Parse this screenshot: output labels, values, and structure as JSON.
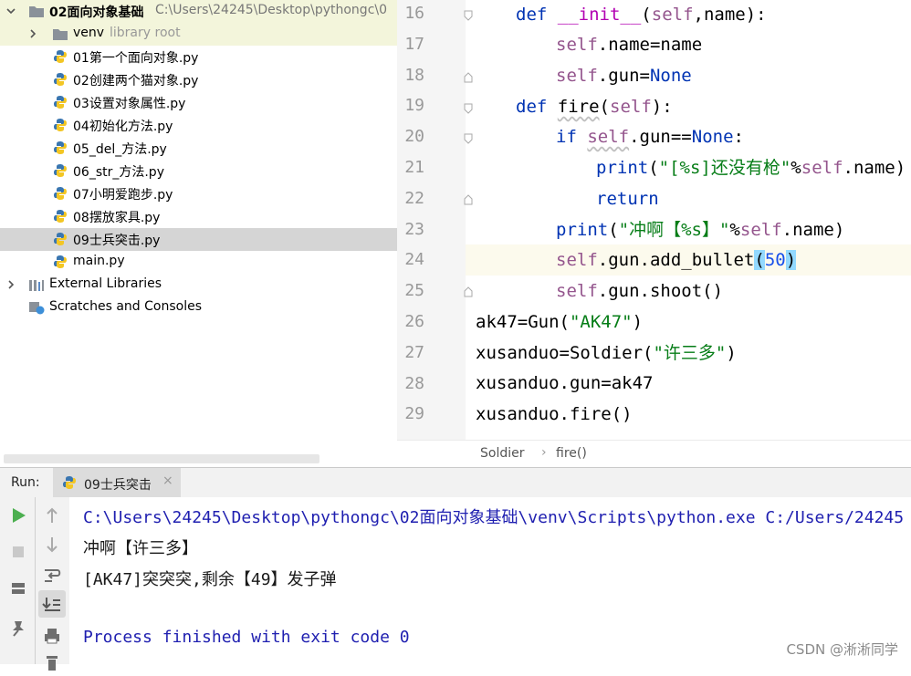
{
  "project_tree": {
    "root": {
      "label": "02面向对象基础",
      "path": "C:\\Users\\24245\\Desktop\\pythongc\\0"
    },
    "venv": {
      "label": "venv",
      "hint": "library root"
    },
    "files": [
      "01第一个面向对象.py",
      "02创建两个猫对象.py",
      "03设置对象属性.py",
      "04初始化方法.py",
      "05_del_方法.py",
      "06_str_方法.py",
      "07小明爱跑步.py",
      "08摆放家具.py",
      "09士兵突击.py",
      "main.py"
    ],
    "selected_file": "09士兵突击.py",
    "external_libraries": "External Libraries",
    "scratches": "Scratches and Consoles"
  },
  "editor": {
    "line_numbers": [
      "16",
      "17",
      "18",
      "19",
      "20",
      "21",
      "22",
      "23",
      "24",
      "25",
      "26",
      "27",
      "28",
      "29"
    ],
    "current_line": "24",
    "code": {
      "l16": {
        "kw": "def",
        "name": "__init__",
        "open": "(",
        "self": "self",
        "rest": ",name):"
      },
      "l17": {
        "self": "self",
        "rest": ".name=name"
      },
      "l18": {
        "self": "self",
        "rest": ".gun=",
        "none": "None"
      },
      "l19": {
        "kw": "def",
        "name": "fire",
        "open": "(",
        "self": "self",
        "rest": "):"
      },
      "l20": {
        "kw": "if",
        "self": "self",
        "mid": ".gun==",
        "none": "None",
        "end": ":"
      },
      "l21": {
        "fn": "print",
        "open": "(",
        "str": "\"[%s]还没有枪\"",
        "pct": "%",
        "self": "self",
        "rest": ".name)"
      },
      "l22": {
        "kw": "return"
      },
      "l23": {
        "fn": "print",
        "open": "(",
        "str": "\"冲啊【%s】\"",
        "pct": "%",
        "self": "self",
        "rest": ".name)"
      },
      "l24": {
        "self": "self",
        "rest": ".gun.add_bullet",
        "lp": "(",
        "num": "50",
        "rp": ")"
      },
      "l25": {
        "self": "self",
        "rest": ".gun.shoot()"
      },
      "l26": {
        "a": "ak47=Gun(",
        "str": "\"AK47\"",
        "b": ")"
      },
      "l27": {
        "a": "xusanduo=Soldier(",
        "str": "\"许三多\"",
        "b": ")"
      },
      "l28": {
        "a": "xusanduo.gun=ak47"
      },
      "l29": {
        "a": "xusanduo.fire()"
      }
    },
    "breadcrumb": [
      "Soldier",
      "fire()"
    ]
  },
  "run": {
    "label": "Run:",
    "tab_label": "09士兵突击",
    "console": [
      "C:\\Users\\24245\\Desktop\\pythongc\\02面向对象基础\\venv\\Scripts\\python.exe C:/Users/24245",
      "冲啊【许三多】",
      "[AK47]突突突,剩余【49】发子弹",
      "",
      "Process finished with exit code 0"
    ]
  },
  "watermark": "CSDN @淅淅同学",
  "colors": {
    "keyword": "#0033b3",
    "self": "#94558d",
    "string": "#067d17",
    "number": "#1750eb",
    "console_path": "#1f1fb0"
  }
}
